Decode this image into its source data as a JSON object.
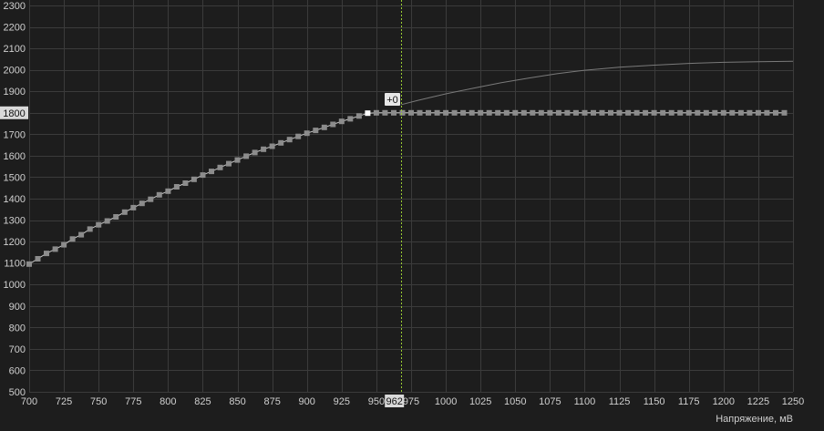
{
  "colors": {
    "background": "#1d1d1d",
    "grid": "#3b3b3b",
    "curve": "#c8c8c8",
    "point": "#8c8c8c",
    "point_selected": "#ffffff",
    "cursor_line": "#9acd32",
    "highlight_box": "#d9d9d9",
    "label_text": "#cfcfcf"
  },
  "chart_data": {
    "type": "line",
    "xlabel": "Напряжение, мВ",
    "ylabel": "",
    "xlim": [
      700,
      1250
    ],
    "ylim": [
      500,
      2300
    ],
    "x_ticks": [
      700,
      725,
      750,
      775,
      800,
      825,
      850,
      875,
      900,
      925,
      950,
      975,
      1000,
      1025,
      1050,
      1075,
      1100,
      1125,
      1150,
      1175,
      1200,
      1225,
      1250
    ],
    "y_ticks": [
      500,
      600,
      700,
      800,
      900,
      1000,
      1100,
      1200,
      1300,
      1400,
      1500,
      1600,
      1700,
      1800,
      1900,
      2000,
      2100,
      2200,
      2300
    ],
    "highlighted_x": {
      "value": 962,
      "label": "962"
    },
    "highlighted_y": {
      "value": 1800,
      "label": "1800"
    },
    "cursor_x": 968,
    "offset_label": "+0",
    "series": [
      {
        "role": "curve-points",
        "x_start": 700,
        "x_step": 6.25,
        "values": [
          1095,
          1120,
          1145,
          1165,
          1185,
          1212,
          1232,
          1258,
          1278,
          1296,
          1315,
          1337,
          1358,
          1378,
          1397,
          1418,
          1435,
          1455,
          1472,
          1490,
          1510,
          1527,
          1545,
          1563,
          1580,
          1598,
          1615,
          1630,
          1644,
          1660,
          1675,
          1690,
          1705,
          1718,
          1732,
          1746,
          1760,
          1772,
          1785,
          1798,
          1800,
          1800,
          1800,
          1800,
          1800,
          1800,
          1800,
          1800,
          1800,
          1800,
          1800,
          1800,
          1800,
          1800,
          1800,
          1800,
          1800,
          1800,
          1800,
          1800,
          1800,
          1800,
          1800,
          1800,
          1800,
          1800,
          1800,
          1800,
          1800,
          1800,
          1800,
          1800,
          1800,
          1800,
          1800,
          1800,
          1800,
          1800,
          1800,
          1800,
          1800,
          1800,
          1800,
          1800,
          1800,
          1800,
          1800,
          1800
        ]
      },
      {
        "role": "default-curve",
        "x": [
          968,
          980,
          1000,
          1020,
          1040,
          1060,
          1080,
          1100,
          1125,
          1150,
          1175,
          1200,
          1225,
          1250
        ],
        "values": [
          1838,
          1858,
          1888,
          1915,
          1940,
          1962,
          1982,
          1998,
          2012,
          2022,
          2030,
          2035,
          2038,
          2040
        ]
      }
    ]
  }
}
